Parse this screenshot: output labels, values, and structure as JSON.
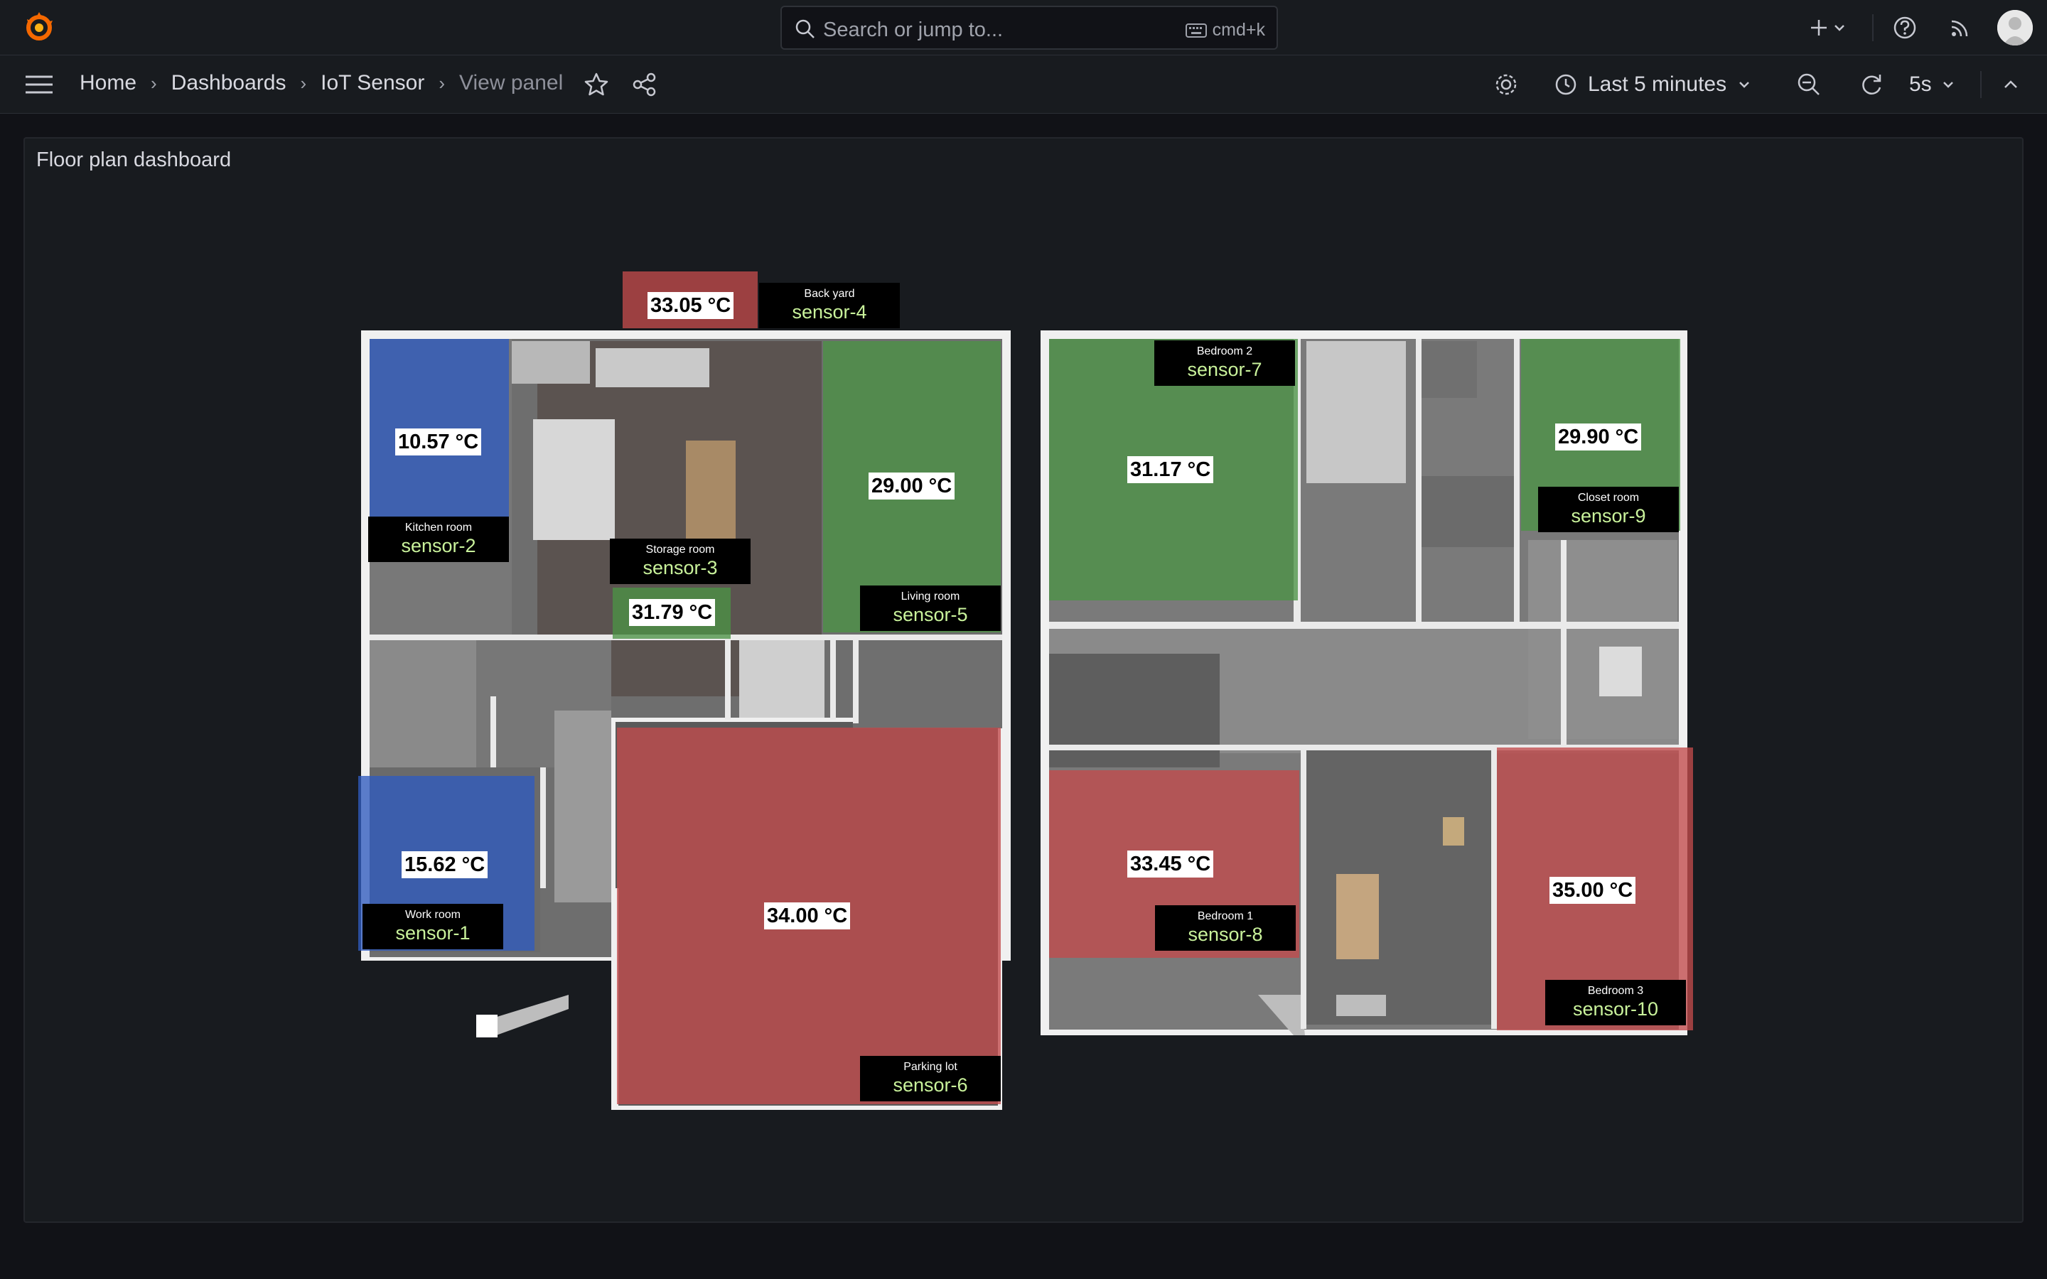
{
  "header": {
    "search_placeholder": "Search or jump to...",
    "search_shortcut": "cmd+k"
  },
  "breadcrumbs": [
    "Home",
    "Dashboards",
    "IoT Sensor",
    "View panel"
  ],
  "toolbar": {
    "time_range": "Last 5 minutes",
    "refresh_interval": "5s"
  },
  "panel": {
    "title": "Floor plan dashboard"
  },
  "sensors": [
    {
      "id": "sensor-1",
      "room": "Work room",
      "temp": "15.62 °C",
      "color": "#2f5bbf"
    },
    {
      "id": "sensor-2",
      "room": "Kitchen room",
      "temp": "10.57 °C",
      "color": "#2f5bbf"
    },
    {
      "id": "sensor-3",
      "room": "Storage room",
      "temp": "31.79 °C",
      "color": "#4b9245"
    },
    {
      "id": "sensor-4",
      "room": "Back yard",
      "temp": "33.05 °C",
      "color": "#c24a4c"
    },
    {
      "id": "sensor-5",
      "room": "Living room",
      "temp": "29.00 °C",
      "color": "#4b9245"
    },
    {
      "id": "sensor-6",
      "room": "Parking lot",
      "temp": "34.00 °C",
      "color": "#c24a4c"
    },
    {
      "id": "sensor-7",
      "room": "Bedroom 2",
      "temp": "31.17 °C",
      "color": "#4b9245"
    },
    {
      "id": "sensor-8",
      "room": "Bedroom 1",
      "temp": "33.45 °C",
      "color": "#c24a4c"
    },
    {
      "id": "sensor-9",
      "room": "Closet room",
      "temp": "29.90 °C",
      "color": "#4b9245"
    },
    {
      "id": "sensor-10",
      "room": "Bedroom 3",
      "temp": "35.00 °C",
      "color": "#c24a4c"
    }
  ]
}
